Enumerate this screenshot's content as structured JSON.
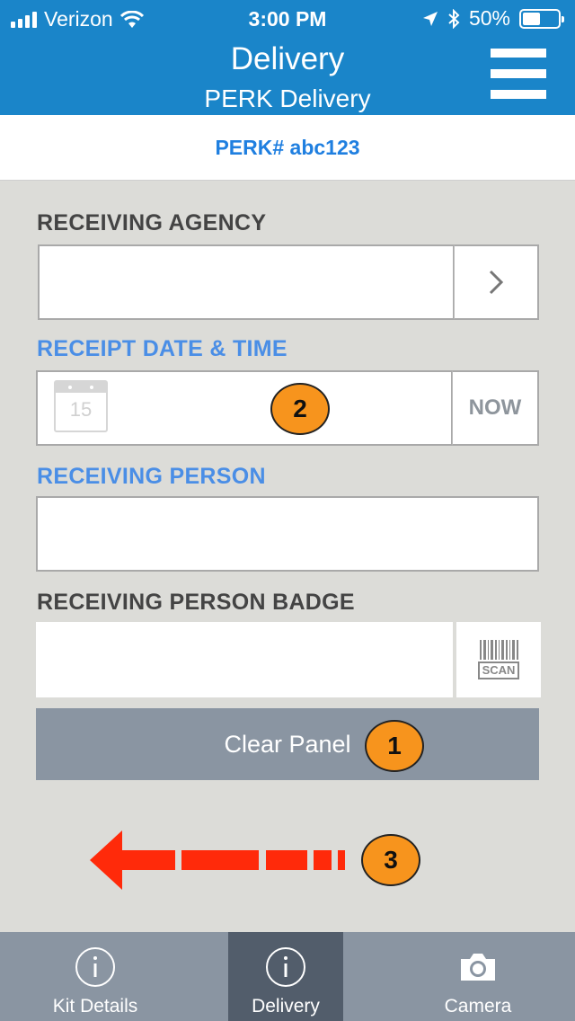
{
  "status_bar": {
    "carrier": "Verizon",
    "time": "3:00 PM",
    "battery": "50%",
    "battery_level": 0.5
  },
  "header": {
    "title": "Delivery",
    "subtitle": "PERK Delivery",
    "menu_icon": "hamburger-menu-icon"
  },
  "perk": {
    "label": "PERK# abc123"
  },
  "form": {
    "receiving_agency": {
      "label": "RECEIVING AGENCY",
      "value": ""
    },
    "receipt_datetime": {
      "label": "RECEIPT DATE & TIME",
      "value": "",
      "calendar_day": "15",
      "now_label": "NOW"
    },
    "receiving_person": {
      "label": "RECEIVING PERSON",
      "value": ""
    },
    "receiving_person_badge": {
      "label": "RECEIVING PERSON BADGE",
      "value": "",
      "scan_label": "SCAN"
    },
    "clear_button": "Clear Panel"
  },
  "annotations": {
    "one": "1",
    "two": "2",
    "three": "3"
  },
  "tabs": [
    {
      "label": "Kit Details",
      "icon": "info-icon",
      "active": false
    },
    {
      "label": "Delivery",
      "icon": "info-icon",
      "active": true
    },
    {
      "label": "Camera",
      "icon": "camera-icon",
      "active": false
    }
  ],
  "colors": {
    "header_blue": "#1a85c9",
    "link_blue": "#1f7fe0",
    "label_blue": "#4a8ee6",
    "button_gray": "#8a95a2",
    "tab_active": "#525d6b",
    "badge_orange": "#f7941d",
    "arrow_red": "#ff2a0a"
  }
}
